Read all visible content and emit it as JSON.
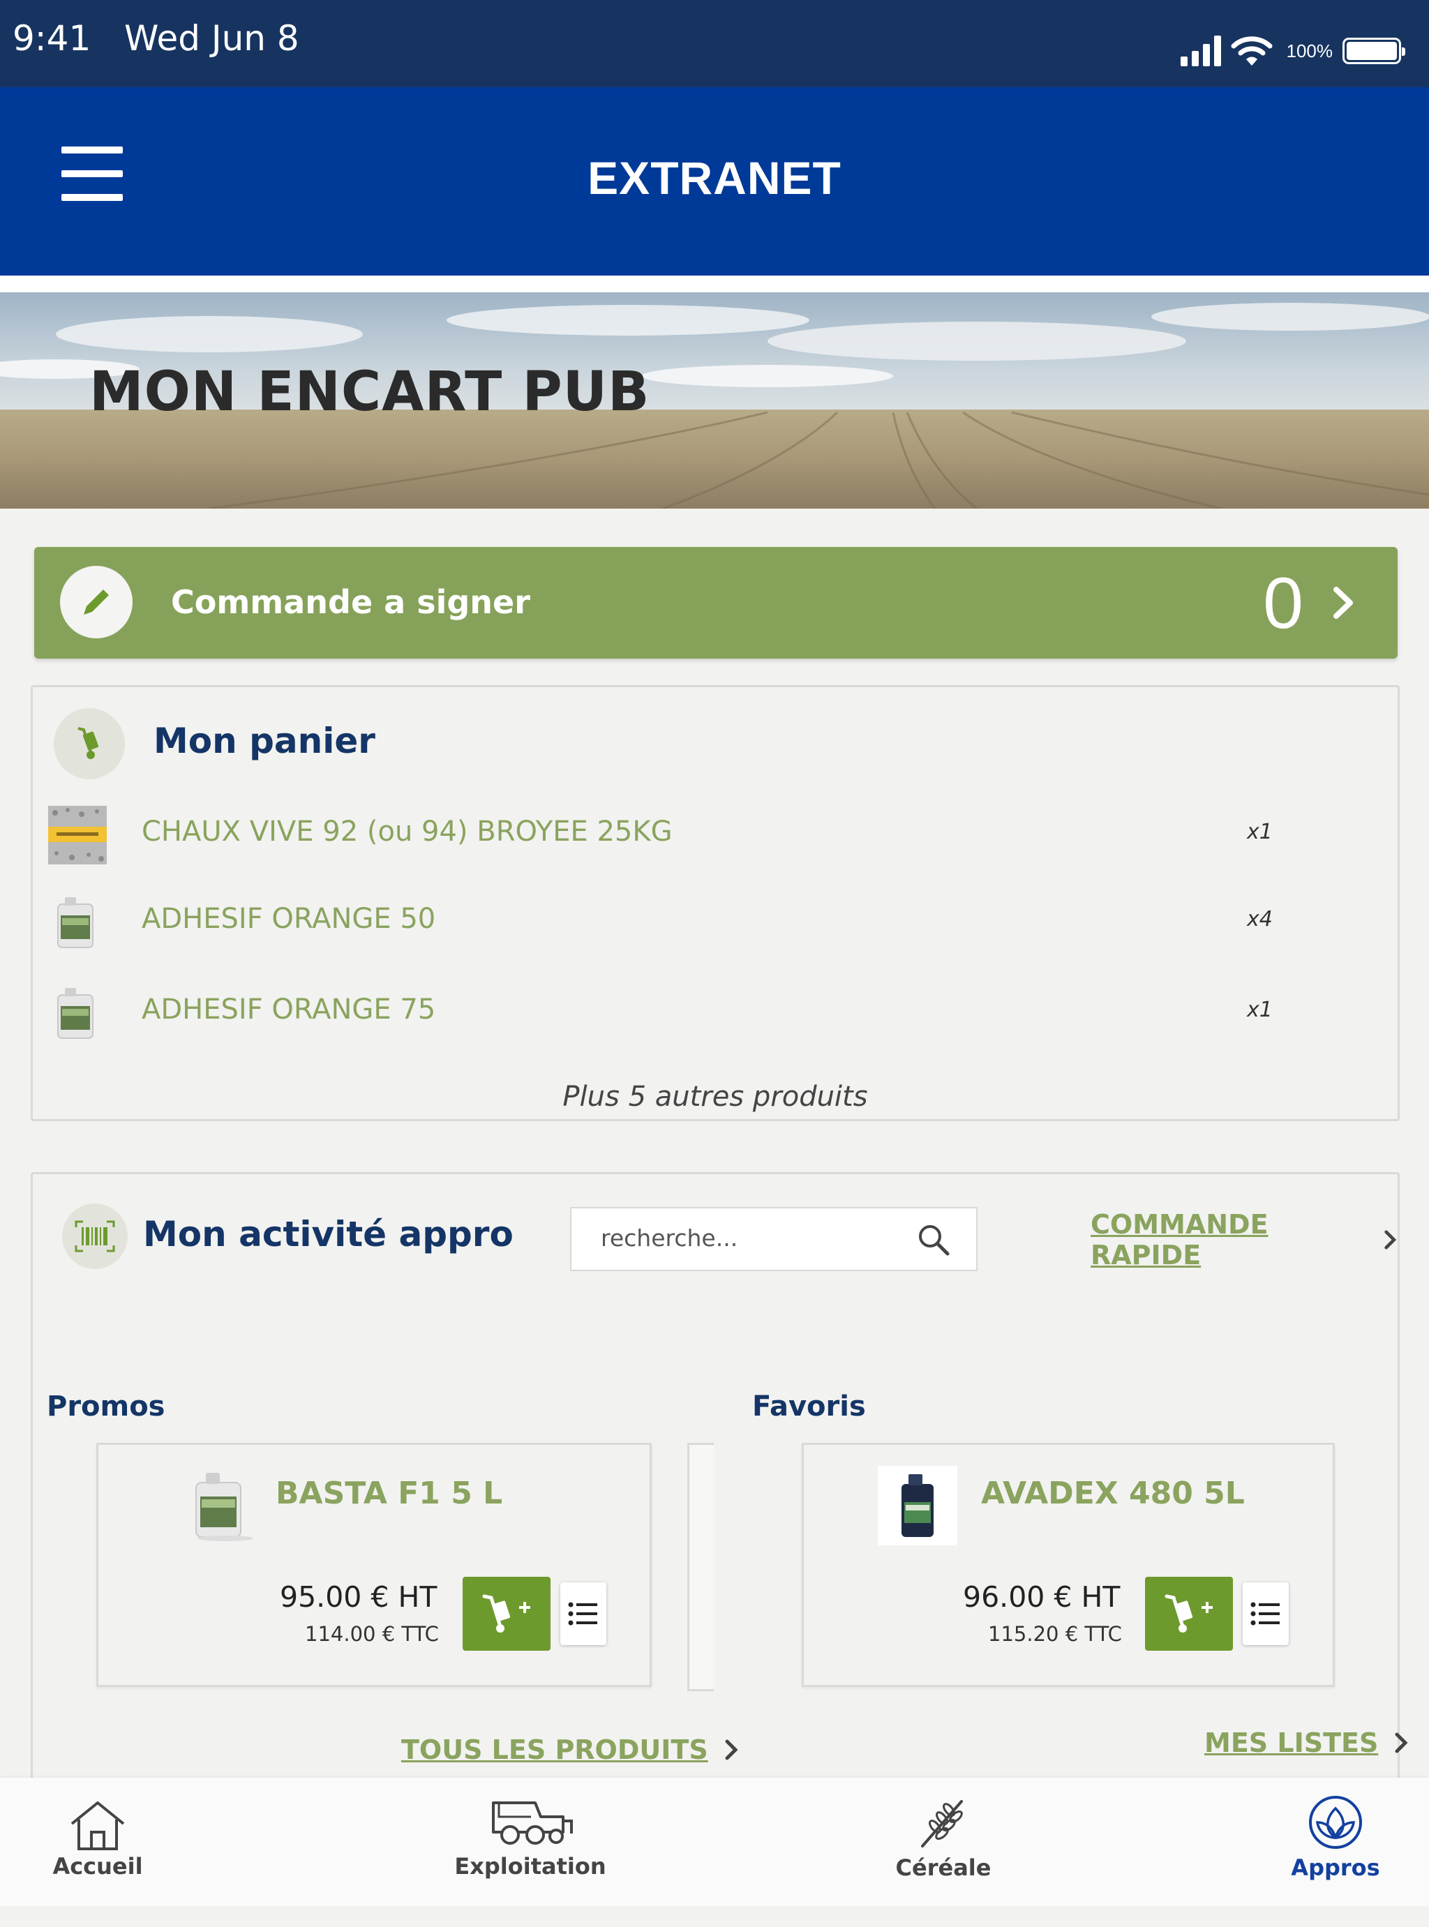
{
  "status_bar": {
    "time": "9:41",
    "date": "Wed Jun 8",
    "battery": "100%"
  },
  "app_bar": {
    "title": "EXTRANET",
    "menu_icon": "hamburger-menu-icon"
  },
  "banner": {
    "title": "MON ENCART PUB"
  },
  "sign": {
    "label": "Commande a signer",
    "count": "0",
    "icon": "pencil-icon"
  },
  "panier": {
    "title": "Mon panier",
    "icon": "hand-truck-icon",
    "items": [
      {
        "name": "CHAUX VIVE 92 (ou 94) BROYEE 25KG",
        "qty": "x1",
        "thumb": "lime-bag-thumbnail"
      },
      {
        "name": "ADHESIF ORANGE 50",
        "qty": "x4",
        "thumb": "canister-thumbnail"
      },
      {
        "name": "ADHESIF ORANGE 75",
        "qty": "x1",
        "thumb": "canister-thumbnail"
      }
    ],
    "more": "Plus 5 autres produits"
  },
  "appro": {
    "title": "Mon activité appro",
    "icon": "barcode-icon",
    "search_placeholder": "recherche...",
    "quick_order": "COMMANDE RAPIDE",
    "promos": {
      "title": "Promos",
      "product": {
        "name": "BASTA F1 5 L",
        "price_ht": "95.00 € HT",
        "price_ttc": "114.00 € TTC"
      },
      "link": "TOUS LES PRODUITS"
    },
    "favoris": {
      "title": "Favoris",
      "product": {
        "name": "AVADEX 480 5L",
        "price_ht": "96.00 € HT",
        "price_ttc": "115.20 € TTC"
      },
      "link": "MES LISTES"
    }
  },
  "tabs": [
    {
      "label": "Accueil",
      "icon": "home-icon"
    },
    {
      "label": "Exploitation",
      "icon": "harvester-icon"
    },
    {
      "label": "Céréale",
      "icon": "wheat-icon"
    },
    {
      "label": "Appros",
      "icon": "leaf-circle-icon",
      "active": true
    }
  ],
  "colors": {
    "status_bar": "#173461",
    "app_bar": "#003a98",
    "accent_green": "#86a25a",
    "button_green": "#6d9a2d",
    "title_navy": "#143566",
    "active_tab": "#1340a0"
  }
}
